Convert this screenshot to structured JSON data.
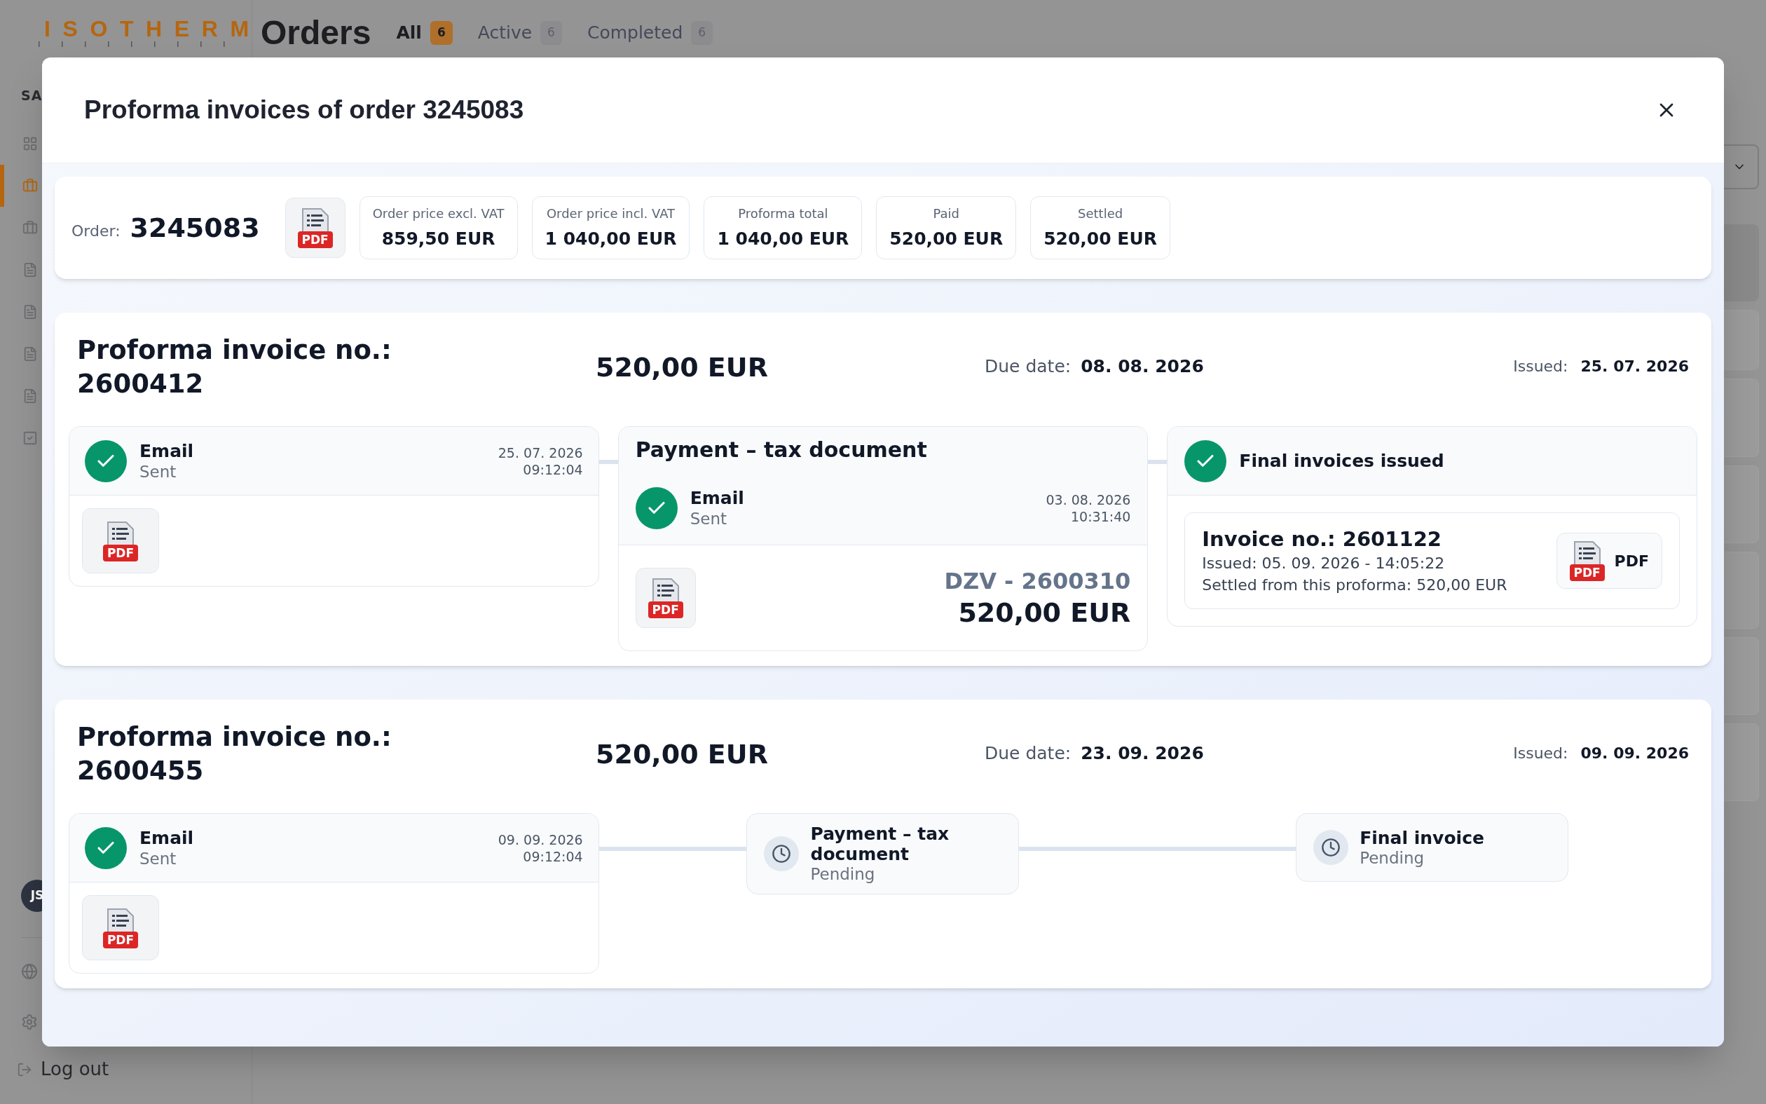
{
  "app": {
    "logo": "ISOTHERM",
    "page_title": "Orders",
    "tabs": [
      {
        "label": "All",
        "count": "6",
        "selected": true
      },
      {
        "label": "Active",
        "count": "6",
        "selected": false
      },
      {
        "label": "Completed",
        "count": "6",
        "selected": false
      }
    ],
    "sidebar": {
      "section_label": "SA",
      "items": [
        {
          "selected": false
        },
        {
          "selected": true
        },
        {
          "selected": false
        },
        {
          "selected": false
        },
        {
          "selected": false
        },
        {
          "selected": false
        },
        {
          "selected": false
        },
        {
          "selected": false
        }
      ],
      "avatar": "JS",
      "logout": "Log out"
    },
    "list_rows": [
      {
        "selected": true
      },
      {
        "selected": false
      },
      {
        "selected": false
      },
      {
        "selected": false
      },
      {
        "selected": false
      },
      {
        "selected": false
      },
      {
        "selected": false
      }
    ]
  },
  "dialog": {
    "title": "Proforma invoices of order 3245083",
    "summary": {
      "order_label": "Order:",
      "order_number": "3245083",
      "pdf_badge": "PDF",
      "stats": [
        {
          "label": "Order price excl. VAT",
          "value": "859,50 EUR"
        },
        {
          "label": "Order price incl. VAT",
          "value": "1 040,00 EUR"
        },
        {
          "label": "Proforma total",
          "value": "1 040,00 EUR"
        },
        {
          "label": "Paid",
          "value": "520,00 EUR"
        },
        {
          "label": "Settled",
          "value": "520,00 EUR"
        }
      ]
    },
    "proformas": [
      {
        "title": "Proforma invoice no.: 2600412",
        "amount": "520,00 EUR",
        "due_label": "Due date:",
        "due_date": "08. 08. 2026",
        "issued_label": "Issued:",
        "issued_date": "25. 07. 2026",
        "steps": [
          {
            "kind": "email",
            "title": "Email",
            "subtitle": "Sent",
            "date": "25. 07. 2026",
            "time": "09:12:04",
            "pdf_badge": "PDF"
          },
          {
            "kind": "payment",
            "heading": "Payment – tax document",
            "title": "Email",
            "subtitle": "Sent",
            "date": "03. 08. 2026",
            "time": "10:31:40",
            "pdf_badge": "PDF",
            "doc_number": "DZV - 2600310",
            "doc_amount": "520,00 EUR"
          },
          {
            "kind": "final",
            "heading": "Final invoices issued",
            "invoice_title": "Invoice no.: 2601122",
            "invoice_issued": "Issued: 05. 09. 2026 - 14:05:22",
            "invoice_settled": "Settled from this proforma: 520,00 EUR",
            "pdf_badge": "PDF",
            "pdf_label": "PDF"
          }
        ]
      },
      {
        "title": "Proforma invoice no.: 2600455",
        "amount": "520,00 EUR",
        "due_label": "Due date:",
        "due_date": "23. 09. 2026",
        "issued_label": "Issued:",
        "issued_date": "09. 09. 2026",
        "steps": [
          {
            "kind": "email",
            "title": "Email",
            "subtitle": "Sent",
            "date": "09. 09. 2026",
            "time": "09:12:04",
            "pdf_badge": "PDF"
          },
          {
            "kind": "pending",
            "title": "Payment – tax document",
            "subtitle": "Pending"
          },
          {
            "kind": "pending",
            "title": "Final invoice",
            "subtitle": "Pending"
          }
        ]
      }
    ]
  }
}
